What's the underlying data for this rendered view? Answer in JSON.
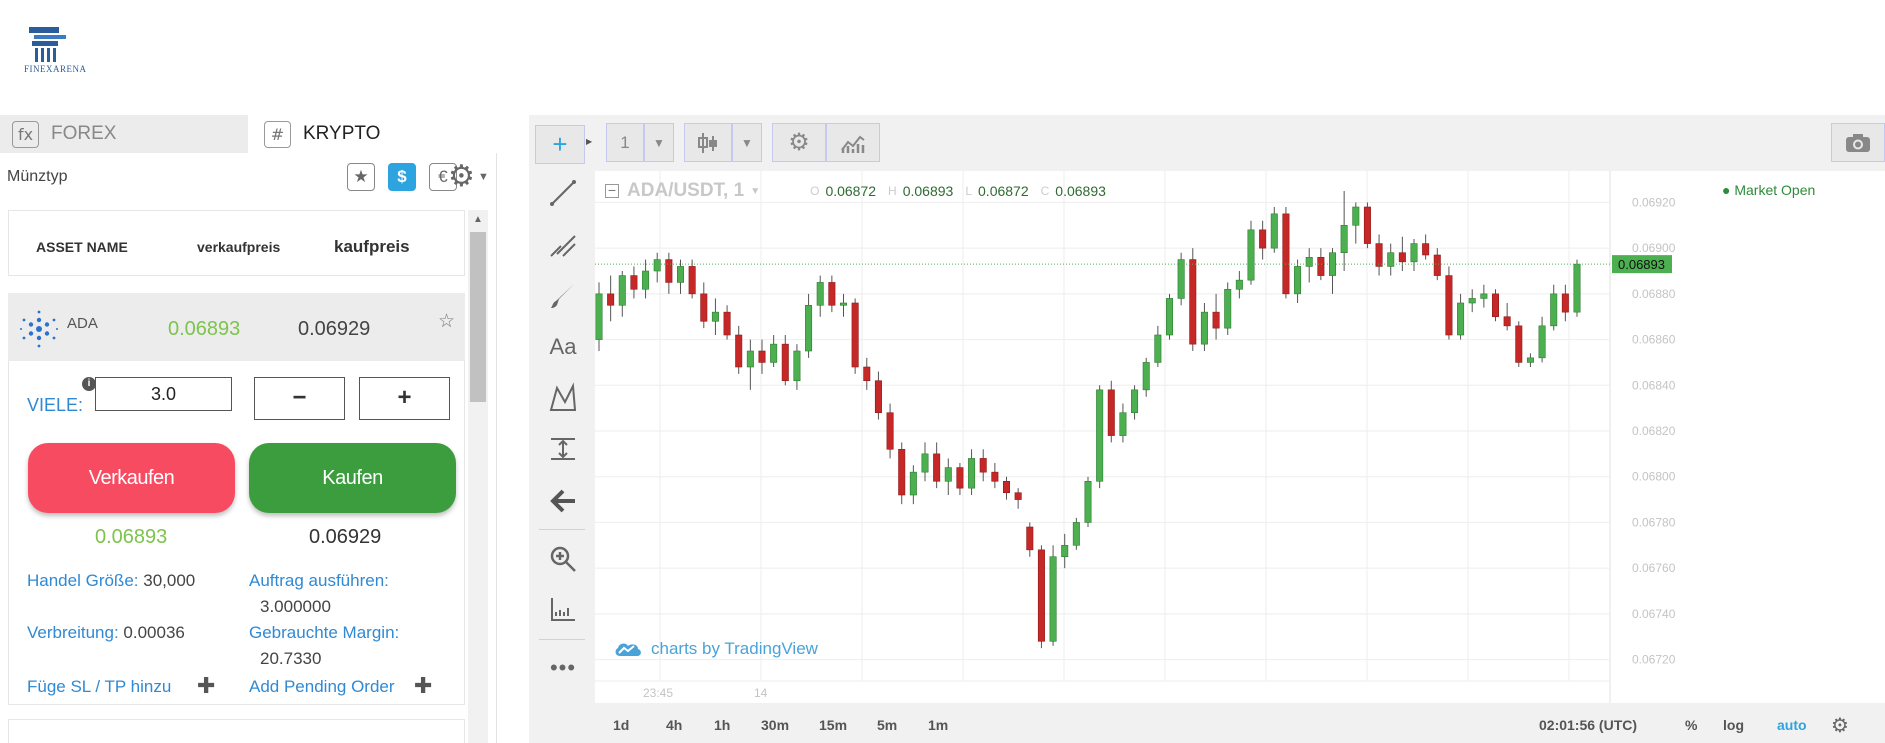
{
  "brand": {
    "name": "FINEXARENA"
  },
  "tabs": [
    {
      "icon": "fx",
      "label": "FOREX"
    },
    {
      "icon": "#",
      "label": "KRYPTO"
    }
  ],
  "filters": {
    "label": "Münztyp",
    "star": "★",
    "dollar": "$",
    "euro": "€"
  },
  "table": {
    "headers": {
      "name": "ASSET NAME",
      "sell": "verkaufpreis",
      "buy": "kaufpreis"
    },
    "rows": [
      {
        "name": "ADA",
        "sell": "0.06893",
        "buy": "0.06929"
      }
    ]
  },
  "trade": {
    "lots_label": "VIELE:",
    "lots_value": "3.0",
    "minus": "−",
    "plus": "+",
    "sell_label": "Verkaufen",
    "buy_label": "Kaufen",
    "sell_price": "0.06893",
    "buy_price": "0.06929",
    "trade_size_label": "Handel Größe:",
    "trade_size_value": "30,000",
    "execute_label": "Auftrag ausführen:",
    "execute_value": "3.000000",
    "spread_label": "Verbreitung:",
    "spread_value": "0.00036",
    "margin_label": "Gebrauchte Margin:",
    "margin_value": "20.7330",
    "add_sltp": "Füge SL / TP hinzu",
    "add_pending": "Add Pending Order"
  },
  "chart_toolbar": {
    "interval": "1"
  },
  "chart_data": {
    "type": "candlestick",
    "symbol": "ADA/USDT, 1",
    "ohlc": {
      "o_label": "O",
      "o": "0.06872",
      "h_label": "H",
      "h": "0.06893",
      "l_label": "L",
      "l": "0.06872",
      "c_label": "C",
      "c": "0.06893"
    },
    "market_status": "● Market Open",
    "last_price": "0.06893",
    "y_ticks": [
      "0.06920",
      "0.06900",
      "0.06880",
      "0.06860",
      "0.06840",
      "0.06820",
      "0.06800",
      "0.06780",
      "0.06760",
      "0.06740",
      "0.06720"
    ],
    "x_ticks": [
      "23:45",
      "14"
    ],
    "ylim": [
      0.06715,
      0.06925
    ],
    "watermark": "charts by TradingView",
    "candles": [
      [
        0.0686,
        0.06885,
        0.06855,
        0.0688
      ],
      [
        0.0688,
        0.06888,
        0.06868,
        0.06875
      ],
      [
        0.06875,
        0.0689,
        0.0687,
        0.06888
      ],
      [
        0.06888,
        0.06892,
        0.06878,
        0.06882
      ],
      [
        0.06882,
        0.06895,
        0.06878,
        0.0689
      ],
      [
        0.0689,
        0.06898,
        0.06885,
        0.06895
      ],
      [
        0.06895,
        0.06898,
        0.0688,
        0.06885
      ],
      [
        0.06885,
        0.06895,
        0.0688,
        0.06892
      ],
      [
        0.06892,
        0.06895,
        0.06878,
        0.0688
      ],
      [
        0.0688,
        0.06885,
        0.06865,
        0.06868
      ],
      [
        0.06868,
        0.06878,
        0.06862,
        0.06872
      ],
      [
        0.06872,
        0.06875,
        0.0686,
        0.06862
      ],
      [
        0.06862,
        0.06866,
        0.06845,
        0.06848
      ],
      [
        0.06848,
        0.0686,
        0.06838,
        0.06855
      ],
      [
        0.06855,
        0.0686,
        0.06845,
        0.0685
      ],
      [
        0.0685,
        0.06862,
        0.06848,
        0.06858
      ],
      [
        0.06858,
        0.06862,
        0.0684,
        0.06842
      ],
      [
        0.06842,
        0.06858,
        0.06838,
        0.06855
      ],
      [
        0.06855,
        0.0688,
        0.06852,
        0.06875
      ],
      [
        0.06875,
        0.06888,
        0.0687,
        0.06885
      ],
      [
        0.06885,
        0.06888,
        0.06872,
        0.06875
      ],
      [
        0.06875,
        0.0688,
        0.0687,
        0.06876
      ],
      [
        0.06876,
        0.06878,
        0.06845,
        0.06848
      ],
      [
        0.06848,
        0.06852,
        0.06838,
        0.06842
      ],
      [
        0.06842,
        0.06846,
        0.06825,
        0.06828
      ],
      [
        0.06828,
        0.06832,
        0.06808,
        0.06812
      ],
      [
        0.06812,
        0.06815,
        0.06788,
        0.06792
      ],
      [
        0.06792,
        0.06805,
        0.06788,
        0.06802
      ],
      [
        0.06802,
        0.06815,
        0.06798,
        0.0681
      ],
      [
        0.0681,
        0.06815,
        0.06795,
        0.06798
      ],
      [
        0.06798,
        0.06808,
        0.06792,
        0.06804
      ],
      [
        0.06804,
        0.06806,
        0.06792,
        0.06795
      ],
      [
        0.06795,
        0.06812,
        0.06792,
        0.06808
      ],
      [
        0.06808,
        0.06812,
        0.06798,
        0.06802
      ],
      [
        0.06802,
        0.06806,
        0.06795,
        0.06798
      ],
      [
        0.06798,
        0.068,
        0.0679,
        0.06793
      ],
      [
        0.06793,
        0.06795,
        0.06786,
        0.0679
      ],
      [
        0.06778,
        0.0678,
        0.06765,
        0.06768
      ],
      [
        0.06768,
        0.0677,
        0.06725,
        0.06728
      ],
      [
        0.06728,
        0.0677,
        0.06726,
        0.06765
      ],
      [
        0.06765,
        0.06775,
        0.0676,
        0.0677
      ],
      [
        0.0677,
        0.06782,
        0.06768,
        0.0678
      ],
      [
        0.0678,
        0.068,
        0.06778,
        0.06798
      ],
      [
        0.06798,
        0.0684,
        0.06795,
        0.06838
      ],
      [
        0.06838,
        0.06842,
        0.06815,
        0.06818
      ],
      [
        0.06818,
        0.06832,
        0.06815,
        0.06828
      ],
      [
        0.06828,
        0.0684,
        0.06825,
        0.06838
      ],
      [
        0.06838,
        0.06852,
        0.06835,
        0.0685
      ],
      [
        0.0685,
        0.06866,
        0.06848,
        0.06862
      ],
      [
        0.06862,
        0.0688,
        0.0686,
        0.06878
      ],
      [
        0.06878,
        0.06898,
        0.06875,
        0.06895
      ],
      [
        0.06895,
        0.069,
        0.06855,
        0.06858
      ],
      [
        0.06858,
        0.06876,
        0.06855,
        0.06872
      ],
      [
        0.06872,
        0.0688,
        0.0686,
        0.06865
      ],
      [
        0.06865,
        0.06885,
        0.06862,
        0.06882
      ],
      [
        0.06882,
        0.0689,
        0.06878,
        0.06886
      ],
      [
        0.06886,
        0.06912,
        0.06884,
        0.06908
      ],
      [
        0.06908,
        0.06912,
        0.06895,
        0.069
      ],
      [
        0.069,
        0.06918,
        0.06898,
        0.06915
      ],
      [
        0.06915,
        0.06918,
        0.06878,
        0.0688
      ],
      [
        0.0688,
        0.06895,
        0.06876,
        0.06892
      ],
      [
        0.06892,
        0.069,
        0.06885,
        0.06896
      ],
      [
        0.06896,
        0.069,
        0.06886,
        0.06888
      ],
      [
        0.06888,
        0.069,
        0.0688,
        0.06898
      ],
      [
        0.06898,
        0.06925,
        0.0689,
        0.0691
      ],
      [
        0.0691,
        0.0692,
        0.06902,
        0.06918
      ],
      [
        0.06918,
        0.0692,
        0.069,
        0.06902
      ],
      [
        0.06902,
        0.06906,
        0.06888,
        0.06892
      ],
      [
        0.06892,
        0.06902,
        0.06888,
        0.06898
      ],
      [
        0.06898,
        0.06905,
        0.0689,
        0.06894
      ],
      [
        0.06894,
        0.06904,
        0.0689,
        0.06902
      ],
      [
        0.06902,
        0.06906,
        0.06895,
        0.06897
      ],
      [
        0.06897,
        0.069,
        0.06886,
        0.06888
      ],
      [
        0.06888,
        0.06892,
        0.0686,
        0.06862
      ],
      [
        0.06862,
        0.0688,
        0.0686,
        0.06876
      ],
      [
        0.06876,
        0.06882,
        0.06872,
        0.06878
      ],
      [
        0.06878,
        0.06884,
        0.06874,
        0.0688
      ],
      [
        0.0688,
        0.06882,
        0.06868,
        0.0687
      ],
      [
        0.0687,
        0.06876,
        0.06864,
        0.06866
      ],
      [
        0.06866,
        0.06868,
        0.06848,
        0.0685
      ],
      [
        0.0685,
        0.06854,
        0.06848,
        0.06852
      ],
      [
        0.06852,
        0.0687,
        0.0685,
        0.06866
      ],
      [
        0.06866,
        0.06884,
        0.06864,
        0.0688
      ],
      [
        0.0688,
        0.06884,
        0.06868,
        0.06872
      ],
      [
        0.06872,
        0.06895,
        0.0687,
        0.06893
      ]
    ]
  },
  "bottom_bar": {
    "timeframes": [
      "1d",
      "4h",
      "1h",
      "30m",
      "15m",
      "5m",
      "1m"
    ],
    "clock": "02:01:56 (UTC)",
    "percent": "%",
    "log": "log",
    "auto": "auto"
  },
  "colors": {
    "sell": "#f74b62",
    "buy": "#3c9d3f",
    "accent": "#2da3e0",
    "bull": "#4caf50",
    "bear": "#c62828"
  }
}
